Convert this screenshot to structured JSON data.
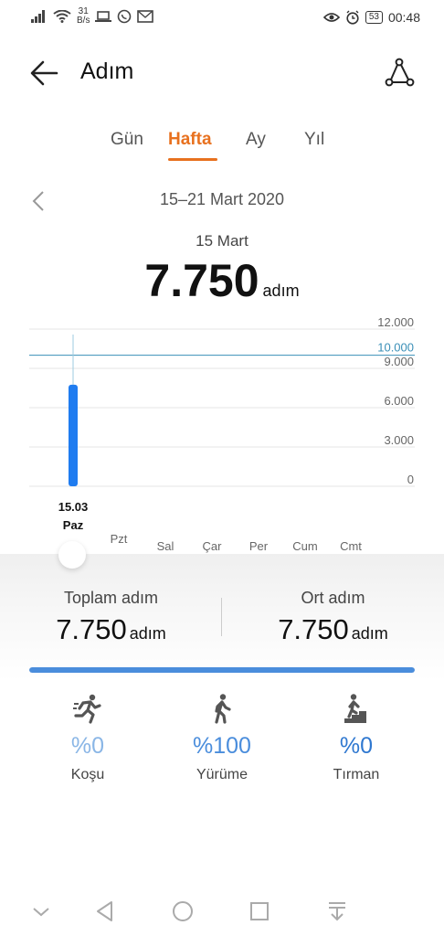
{
  "status_bar": {
    "net_speed_value": "31",
    "net_speed_unit": "B/s",
    "battery": "53",
    "time": "00:48"
  },
  "header": {
    "title": "Adım",
    "back_icon": "arrow-left-icon",
    "share_icon": "share-icon"
  },
  "tabs": [
    {
      "label": "Gün",
      "active": false
    },
    {
      "label": "Hafta",
      "active": true
    },
    {
      "label": "Ay",
      "active": false
    },
    {
      "label": "Yıl",
      "active": false
    }
  ],
  "date_range": "15–21 Mart 2020",
  "selected": {
    "date": "15 Mart",
    "value": "7.750",
    "unit": "adım"
  },
  "chart_data": {
    "type": "bar",
    "categories": [
      "Paz",
      "Pzt",
      "Sal",
      "Çar",
      "Per",
      "Cum",
      "Cmt"
    ],
    "values": [
      7750,
      0,
      0,
      0,
      0,
      0,
      0
    ],
    "selected_index": 0,
    "selected_label": "15.03",
    "y_ticks": [
      "12.000",
      "9.000",
      "6.000",
      "3.000",
      "0"
    ],
    "ylim": [
      0,
      12000
    ],
    "goal": 10000,
    "goal_label": "10.000",
    "bar_color": "#1f7cf0",
    "goal_color": "#3a8fb7"
  },
  "summary": {
    "total_label": "Toplam adım",
    "total_value": "7.750",
    "total_unit": "adım",
    "avg_label": "Ort adım",
    "avg_value": "7.750",
    "avg_unit": "adım",
    "progress": 1.0
  },
  "activities": [
    {
      "pct": "%0",
      "label": "Koşu",
      "icon": "running-icon",
      "color": "#8ab6e6"
    },
    {
      "pct": "%100",
      "label": "Yürüme",
      "icon": "walking-icon",
      "color": "#4a8ddc"
    },
    {
      "pct": "%0",
      "label": "Tırman",
      "icon": "climbing-icon",
      "color": "#2f78d0"
    }
  ],
  "nav": [
    "chevron-down-icon",
    "back-triangle-icon",
    "home-circle-icon",
    "recents-square-icon",
    "download-icon"
  ]
}
